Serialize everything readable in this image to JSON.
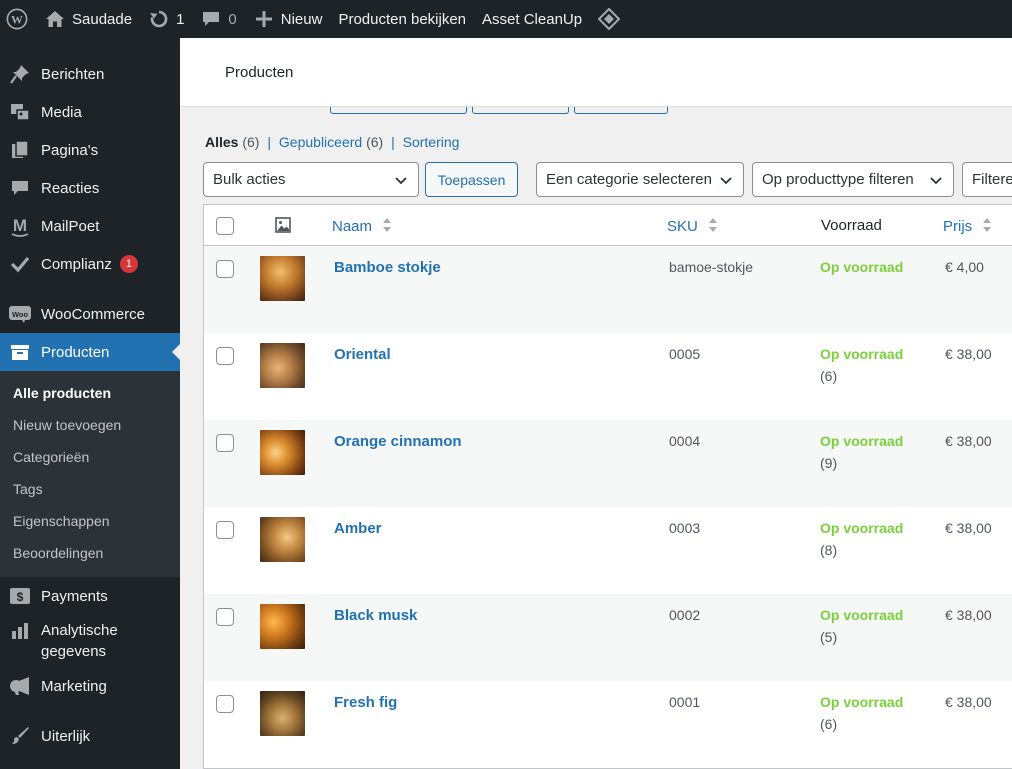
{
  "adminbar": {
    "site_name": "Saudade",
    "updates_count": "1",
    "comments_count": "0",
    "new_label": "Nieuw",
    "view_products": "Producten bekijken",
    "asset_cleanup": "Asset CleanUp"
  },
  "sidebar": {
    "items": [
      {
        "label": "Berichten",
        "icon": "pushpin-icon"
      },
      {
        "label": "Media",
        "icon": "media-icon"
      },
      {
        "label": "Pagina's",
        "icon": "pages-icon"
      },
      {
        "label": "Reacties",
        "icon": "comments-icon"
      },
      {
        "label": "MailPoet",
        "icon": "mailpoet-icon"
      },
      {
        "label": "Complianz",
        "icon": "checkmark-icon",
        "badge": "1"
      },
      {
        "label": "WooCommerce",
        "icon": "woo-icon"
      },
      {
        "label": "Producten",
        "icon": "archive-icon"
      },
      {
        "label": "Payments",
        "icon": "dollar-icon"
      },
      {
        "label": "Analytische gegevens",
        "icon": "bar-chart-icon"
      },
      {
        "label": "Marketing",
        "icon": "megaphone-icon"
      },
      {
        "label": "Uiterlijk",
        "icon": "brush-icon"
      }
    ],
    "submenu": [
      "Alle producten",
      "Nieuw toevoegen",
      "Categorieën",
      "Tags",
      "Eigenschappen",
      "Beoordelingen"
    ]
  },
  "header": {
    "title": "Producten",
    "page_heading": "Producten"
  },
  "filters": {
    "all_label": "Alles",
    "all_count": "(6)",
    "published_label": "Gepubliceerd",
    "published_count": "(6)",
    "sorting_label": "Sortering",
    "bulk_actions": "Bulk acties",
    "apply": "Toepassen",
    "category": "Een categorie selecteren",
    "product_type": "Op producttype filteren",
    "stock_filter": "Filtere"
  },
  "table": {
    "columns": {
      "name": "Naam",
      "sku": "SKU",
      "stock": "Voorraad",
      "price": "Prijs"
    },
    "rows": [
      {
        "name": "Bamboe stokje",
        "sku": "bamoe-stokje",
        "stock": "Op voorraad",
        "stock_count": "",
        "price": "€ 4,00"
      },
      {
        "name": "Oriental",
        "sku": "0005",
        "stock": "Op voorraad",
        "stock_count": "(6)",
        "price": "€ 38,00"
      },
      {
        "name": "Orange cinnamon",
        "sku": "0004",
        "stock": "Op voorraad",
        "stock_count": "(9)",
        "price": "€ 38,00"
      },
      {
        "name": "Amber",
        "sku": "0003",
        "stock": "Op voorraad",
        "stock_count": "(8)",
        "price": "€ 38,00"
      },
      {
        "name": "Black musk",
        "sku": "0002",
        "stock": "Op voorraad",
        "stock_count": "(5)",
        "price": "€ 38,00"
      },
      {
        "name": "Fresh fig",
        "sku": "0001",
        "stock": "Op voorraad",
        "stock_count": "(6)",
        "price": "€ 38,00"
      }
    ]
  },
  "colors": {
    "admin_dark": "#1d2327",
    "accent_blue": "#2271b1",
    "in_stock_green": "#7ad03a",
    "badge_red": "#d63638"
  }
}
